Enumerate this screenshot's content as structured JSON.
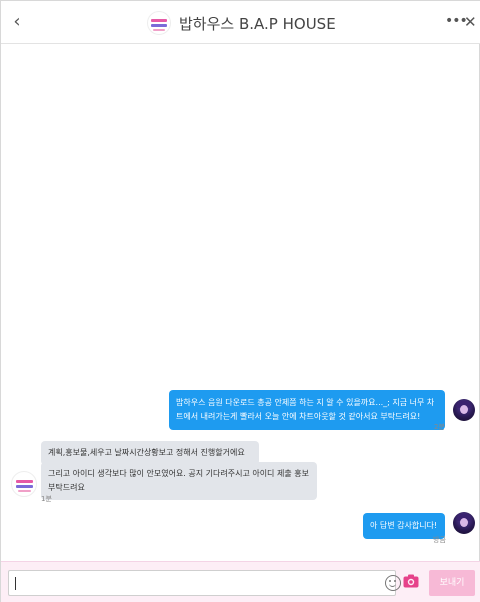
{
  "header": {
    "title": "밥하우스 B.A.P HOUSE",
    "back_glyph": "‹",
    "more_glyph": "•••",
    "close_glyph": "✕"
  },
  "messages": [
    {
      "side": "out",
      "text": "밥하우스 음원 다운로드 총공 안제쯤 하는 지 알 수 있을까요..._; 지금 너무 차트에서 내려가는게 빨라서 오늘 안에 차트아웃할 것 같아서요 부탁드려요!",
      "time": "2분"
    },
    {
      "side": "in",
      "text": "계획,홍보물,세우고 날짜시간상황보고 정해서 진행할거에요"
    },
    {
      "side": "in",
      "text": "그리고 아이디 생각보다 많이 안모였어요. 공지 기다려주시고 아이디 제출 홍보 부탁드려요",
      "time": "1분"
    },
    {
      "side": "out",
      "text": "아 답변 감사합니다!",
      "time": "방금"
    }
  ],
  "input": {
    "value": "",
    "send_label": "보내기"
  },
  "icons": {
    "back": "chevron-left-icon",
    "more": "more-dots-icon",
    "close": "close-icon",
    "emoji": "emoji-icon",
    "camera": "camera-icon"
  },
  "colors": {
    "accent": "#1e9bf0",
    "incoming": "#e2e5ea",
    "input_bar": "#fdeef6",
    "send_button": "#f7b9d6",
    "camera": "#e6428a"
  }
}
